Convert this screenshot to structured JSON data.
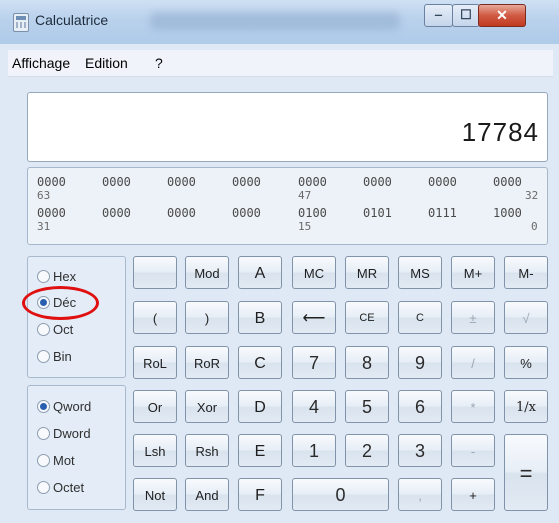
{
  "window": {
    "title": "Calculatrice",
    "min_glyph": "‒",
    "max_glyph": "☐",
    "close_glyph": "✕"
  },
  "menu": {
    "items": [
      "Affichage",
      "Edition",
      "?"
    ]
  },
  "display": {
    "value": "17784"
  },
  "bits": {
    "row1": [
      "0000",
      "0000",
      "0000",
      "0000",
      "0000",
      "0000",
      "0000",
      "0000"
    ],
    "row1_positions": [
      "63",
      "47",
      "32"
    ],
    "row2": [
      "0000",
      "0000",
      "0000",
      "0000",
      "0100",
      "0101",
      "0111",
      "1000"
    ],
    "row2_positions": [
      "31",
      "15",
      "0"
    ]
  },
  "base": {
    "options": [
      "Hex",
      "Déc",
      "Oct",
      "Bin"
    ],
    "selected": "Déc"
  },
  "word": {
    "options": [
      "Qword",
      "Dword",
      "Mot",
      "Octet"
    ],
    "selected": "Qword"
  },
  "keys": {
    "row1": [
      "",
      "Mod",
      "A",
      "MC",
      "MR",
      "MS",
      "M+",
      "M-"
    ],
    "row2": [
      "(",
      ")",
      "B",
      "⟵",
      "CE",
      "C",
      "±",
      "√"
    ],
    "row3": [
      "RoL",
      "RoR",
      "C",
      "7",
      "8",
      "9",
      "/",
      "%"
    ],
    "row4": [
      "Or",
      "Xor",
      "D",
      "4",
      "5",
      "6",
      "*",
      "1/x"
    ],
    "row5": [
      "Lsh",
      "Rsh",
      "E",
      "1",
      "2",
      "3",
      "-",
      "="
    ],
    "row6": [
      "Not",
      "And",
      "F",
      "0",
      ",",
      "+"
    ]
  },
  "annotation": {
    "color": "#e01010"
  }
}
